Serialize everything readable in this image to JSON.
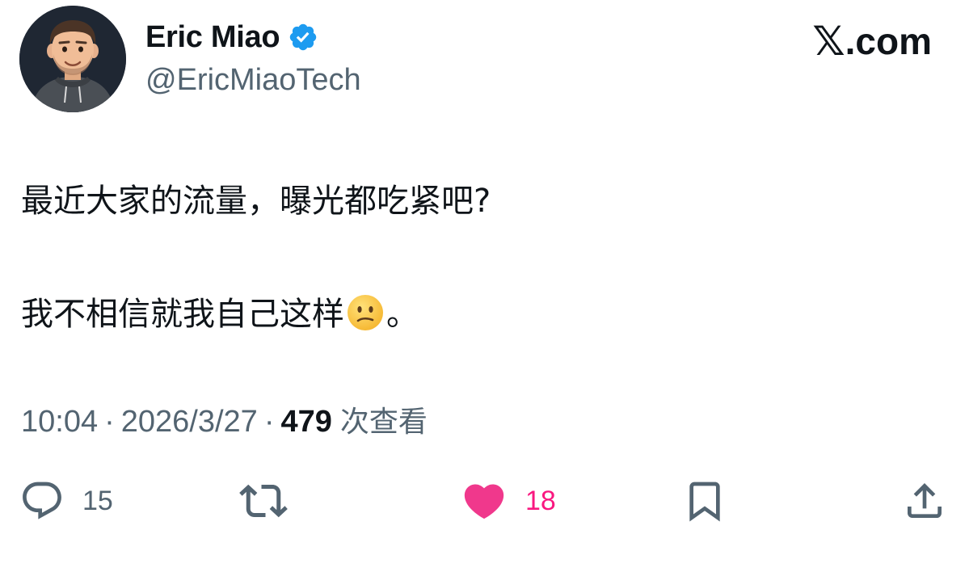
{
  "author": {
    "display_name": "Eric Miao",
    "handle": "@EricMiaoTech",
    "verified": true,
    "verified_color": "#1d9bf0"
  },
  "site_mark": {
    "logo": "𝕏",
    "text": ".com"
  },
  "tweet": {
    "lines": [
      "最近大家的流量，曝光都吃紧吧?",
      "我不相信就我自己这样"
    ],
    "emoji": "confused-face-emoji",
    "line2_suffix": "。"
  },
  "meta": {
    "time": "10:04",
    "separator": "·",
    "date": "2026/3/27",
    "views": "479",
    "views_label": "次查看"
  },
  "actions": {
    "reply_count": "15",
    "retweet_count": "",
    "like_count": "18",
    "liked": true,
    "like_color": "#f91880",
    "icon_color": "#536471"
  }
}
